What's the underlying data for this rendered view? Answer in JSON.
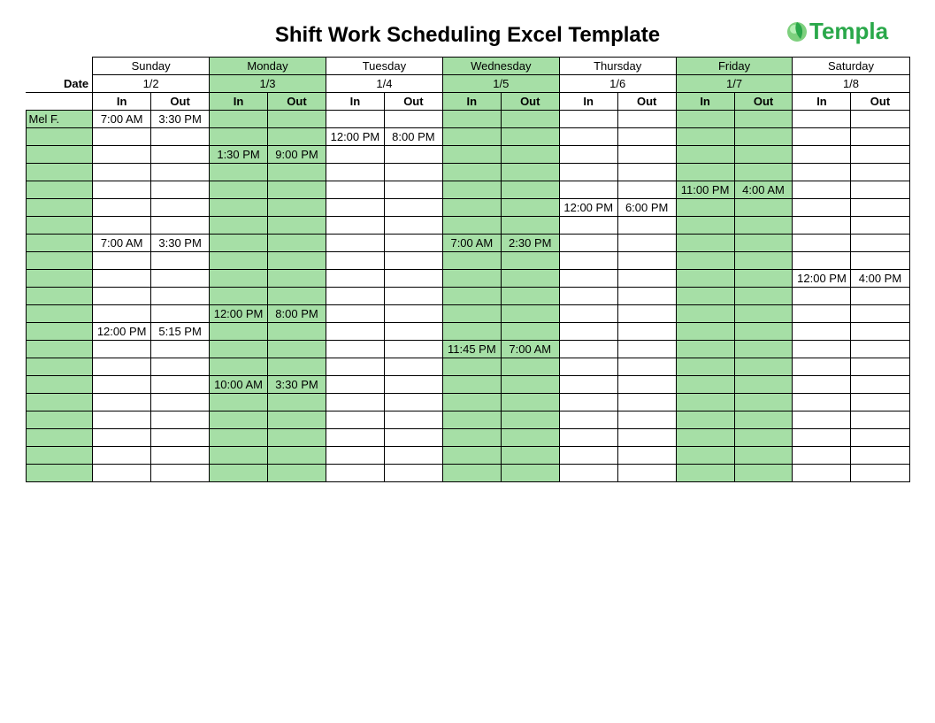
{
  "title": "Shift Work Scheduling Excel Template",
  "brand": "Templa",
  "date_label": "Date",
  "days": [
    {
      "name": "Sunday",
      "date": "1/2",
      "highlight": false
    },
    {
      "name": "Monday",
      "date": "1/3",
      "highlight": true
    },
    {
      "name": "Tuesday",
      "date": "1/4",
      "highlight": false
    },
    {
      "name": "Wednesday",
      "date": "1/5",
      "highlight": true
    },
    {
      "name": "Thursday",
      "date": "1/6",
      "highlight": false
    },
    {
      "name": "Friday",
      "date": "1/7",
      "highlight": true
    },
    {
      "name": "Saturday",
      "date": "1/8",
      "highlight": false
    }
  ],
  "inout": {
    "in": "In",
    "out": "Out"
  },
  "rows": [
    {
      "name": "Mel F.",
      "cells": [
        "7:00 AM",
        "3:30 PM",
        "",
        "",
        "",
        "",
        "",
        "",
        "",
        "",
        "",
        "",
        "",
        ""
      ]
    },
    {
      "name": "",
      "cells": [
        "",
        "",
        "",
        "",
        "12:00 PM",
        "8:00 PM",
        "",
        "",
        "",
        "",
        "",
        "",
        "",
        ""
      ]
    },
    {
      "name": "",
      "cells": [
        "",
        "",
        "1:30 PM",
        "9:00 PM",
        "",
        "",
        "",
        "",
        "",
        "",
        "",
        "",
        "",
        ""
      ]
    },
    {
      "name": "",
      "cells": [
        "",
        "",
        "",
        "",
        "",
        "",
        "",
        "",
        "",
        "",
        "",
        "",
        "",
        ""
      ]
    },
    {
      "name": "",
      "cells": [
        "",
        "",
        "",
        "",
        "",
        "",
        "",
        "",
        "",
        "",
        "11:00 PM",
        "4:00 AM",
        "",
        ""
      ]
    },
    {
      "name": "",
      "cells": [
        "",
        "",
        "",
        "",
        "",
        "",
        "",
        "",
        "12:00 PM",
        "6:00 PM",
        "",
        "",
        "",
        ""
      ]
    },
    {
      "name": "",
      "cells": [
        "",
        "",
        "",
        "",
        "",
        "",
        "",
        "",
        "",
        "",
        "",
        "",
        "",
        ""
      ]
    },
    {
      "name": "",
      "cells": [
        "7:00 AM",
        "3:30 PM",
        "",
        "",
        "",
        "",
        "7:00 AM",
        "2:30 PM",
        "",
        "",
        "",
        "",
        "",
        ""
      ]
    },
    {
      "name": "",
      "cells": [
        "",
        "",
        "",
        "",
        "",
        "",
        "",
        "",
        "",
        "",
        "",
        "",
        "",
        ""
      ]
    },
    {
      "name": "",
      "cells": [
        "",
        "",
        "",
        "",
        "",
        "",
        "",
        "",
        "",
        "",
        "",
        "",
        "12:00 PM",
        "4:00 PM"
      ]
    },
    {
      "name": "",
      "cells": [
        "",
        "",
        "",
        "",
        "",
        "",
        "",
        "",
        "",
        "",
        "",
        "",
        "",
        ""
      ]
    },
    {
      "name": "",
      "cells": [
        "",
        "",
        "12:00 PM",
        "8:00 PM",
        "",
        "",
        "",
        "",
        "",
        "",
        "",
        "",
        "",
        ""
      ]
    },
    {
      "name": "",
      "cells": [
        "12:00 PM",
        "5:15 PM",
        "",
        "",
        "",
        "",
        "",
        "",
        "",
        "",
        "",
        "",
        "",
        ""
      ]
    },
    {
      "name": "",
      "cells": [
        "",
        "",
        "",
        "",
        "",
        "",
        "11:45 PM",
        "7:00 AM",
        "",
        "",
        "",
        "",
        "",
        ""
      ]
    },
    {
      "name": "",
      "cells": [
        "",
        "",
        "",
        "",
        "",
        "",
        "",
        "",
        "",
        "",
        "",
        "",
        "",
        ""
      ]
    },
    {
      "name": "",
      "cells": [
        "",
        "",
        "10:00 AM",
        "3:30 PM",
        "",
        "",
        "",
        "",
        "",
        "",
        "",
        "",
        "",
        ""
      ]
    },
    {
      "name": "",
      "cells": [
        "",
        "",
        "",
        "",
        "",
        "",
        "",
        "",
        "",
        "",
        "",
        "",
        "",
        ""
      ]
    },
    {
      "name": "",
      "cells": [
        "",
        "",
        "",
        "",
        "",
        "",
        "",
        "",
        "",
        "",
        "",
        "",
        "",
        ""
      ]
    },
    {
      "name": "",
      "cells": [
        "",
        "",
        "",
        "",
        "",
        "",
        "",
        "",
        "",
        "",
        "",
        "",
        "",
        ""
      ]
    },
    {
      "name": "",
      "cells": [
        "",
        "",
        "",
        "",
        "",
        "",
        "",
        "",
        "",
        "",
        "",
        "",
        "",
        ""
      ]
    },
    {
      "name": "",
      "cells": [
        "",
        "",
        "",
        "",
        "",
        "",
        "",
        "",
        "",
        "",
        "",
        "",
        "",
        ""
      ]
    }
  ]
}
